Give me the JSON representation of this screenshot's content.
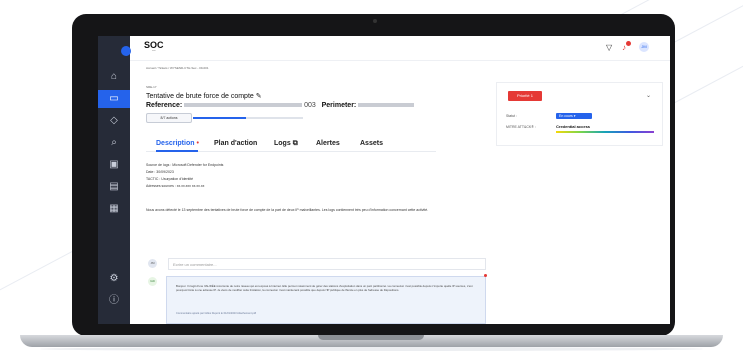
{
  "app": {
    "logo": "SOC",
    "breadcrumb": "Accueil  /  Tickets  /  WYSEND-CTH-Sec - 09-001",
    "ticket_tag": "SRE-17"
  },
  "ticket": {
    "title": "Tentative de brute force de compte",
    "reference_label": "Reference:",
    "reference_value": "003",
    "perimeter_label": "Perimeter:",
    "actions_label": "8/7 actions",
    "progress": 0.48
  },
  "tabs": [
    {
      "label": "Description"
    },
    {
      "label": "Plan d'action"
    },
    {
      "label": "Logs"
    },
    {
      "label": "Alertes"
    },
    {
      "label": "Assets"
    }
  ],
  "details": {
    "source": "Source de logs : Microsoft Defender for Endpoints",
    "date": "Date : 30/09/2023",
    "tactic": "TACTIC : Usurpation d'identité",
    "addresses": "Adresses sources : xx.xx.xxx xx.xx.xx",
    "paragraph": "Nous avons détecté le 13 septembre des tentatives de brute force de compte de la part de deux IP malveillantes. Les logs contiennent très peu d'information concernant cette activité."
  },
  "panel": {
    "priority_label": "Priorité 1",
    "status_label": "Statut :",
    "status_value": "En cours",
    "mitre_label": "MITRE ATT&CK® :",
    "mitre_value": "Credential access"
  },
  "comments": {
    "input_placeholder": "Ecrire un commentaire...",
    "text": "Bonjour. Il s'agit d'une VALIDÉE récurrente de notre réseau qui est exposé à Internet. Elle permet notamment de gérer des stations d'exploitation dans un parc partitionné. La connexion n'est possible depuis n'importe quelle IP sources, c'est pourquoi limite à une adresse IP. Je viens de modifier cette limitation, la connexion n'est maintenant possible que depuis l'IP publique de l'Ecole en plus de l'adresse de Dépositions.",
    "meta": "Commentaire ajouté par Gilles Dupont le 01/01/2023      Attachement.pdf"
  }
}
